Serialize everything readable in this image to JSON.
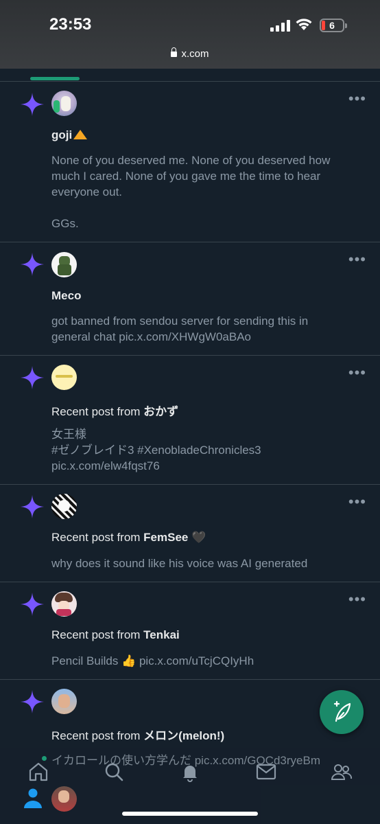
{
  "status_bar": {
    "time": "23:53",
    "battery": "6",
    "url": "x.com"
  },
  "feed": [
    {
      "name": "goji",
      "name_prefix": "",
      "body_lines": [
        "None of you deserved me. None of you deserved how",
        "much I cared. None of you gave me the time to hear",
        "everyone out.",
        "",
        "GGs."
      ]
    },
    {
      "name": "Meco",
      "name_prefix": "",
      "body_lines": [
        "got banned from sendou server for sending this in",
        "general chat pic.x.com/XHWgW0aBAo"
      ]
    },
    {
      "name": "おかず",
      "name_prefix": "Recent post from ",
      "body_lines": [
        "女王様",
        "#ゼノブレイド3 #XenobladeChronicles3",
        "pic.x.com/elw4fqst76"
      ]
    },
    {
      "name": "FemSee",
      "name_prefix": "Recent post from ",
      "name_suffix_emoji": "🖤",
      "body_lines": [
        "why does it sound like his voice was AI generated"
      ]
    },
    {
      "name": "Tenkai",
      "name_prefix": "Recent post from ",
      "body_lines": [
        "Pencil Builds 👍 pic.x.com/uTcjCQIyHh"
      ]
    },
    {
      "name": "メロン(melon!)",
      "name_prefix": "Recent post from ",
      "body_lines": []
    }
  ],
  "peek_text": "イカロールの使い方学んだ pic.x.com/GOCd3ryeBm",
  "icons": {
    "spark": "sparkle-icon",
    "more": "more-icon",
    "compose": "compose-icon",
    "nav": [
      "home-icon",
      "search-icon",
      "notifications-icon",
      "messages-icon",
      "communities-icon"
    ]
  },
  "colors": {
    "accent": "#1d9b76",
    "spark": "#7856ff",
    "background": "#15202b"
  }
}
